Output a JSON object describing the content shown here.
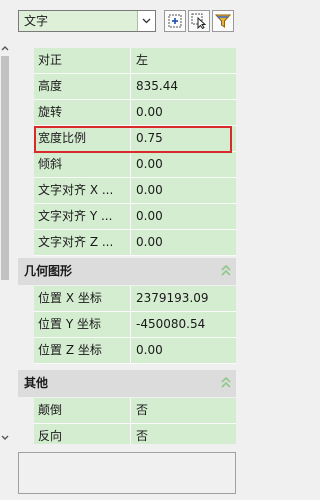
{
  "toolbar": {
    "type_combo": {
      "value": "文字"
    }
  },
  "groups": [
    {
      "title": "",
      "rows": [
        {
          "label": "对正",
          "value": "左"
        },
        {
          "label": "高度",
          "value": "835.44"
        },
        {
          "label": "旋转",
          "value": "0.00"
        },
        {
          "label": "宽度比例",
          "value": "0.75",
          "highlighted": true
        },
        {
          "label": "倾斜",
          "value": "0.00"
        },
        {
          "label": "文字对齐 X ...",
          "value": "0.00"
        },
        {
          "label": "文字对齐 Y ...",
          "value": "0.00"
        },
        {
          "label": "文字对齐 Z ...",
          "value": "0.00"
        }
      ]
    },
    {
      "title": "几何图形",
      "rows": [
        {
          "label": "位置 X 坐标",
          "value": "2379193.09"
        },
        {
          "label": "位置 Y 坐标",
          "value": "-450080.54"
        },
        {
          "label": "位置 Z 坐标",
          "value": "0.00"
        }
      ]
    },
    {
      "title": "其他",
      "rows": [
        {
          "label": "颠倒",
          "value": "否"
        },
        {
          "label": "反向",
          "value": "否"
        }
      ]
    }
  ],
  "colors": {
    "row_background": "#d4edd0",
    "section_header": "#dcdcdc",
    "highlight_border": "#d82a2a"
  }
}
